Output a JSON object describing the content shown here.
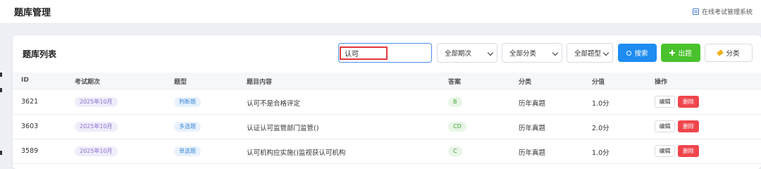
{
  "header": {
    "title": "题库管理",
    "system_link": "在线考试管理系统",
    "system_icon": "document-icon"
  },
  "panel": {
    "title": "题库列表",
    "search": {
      "value": "认可",
      "placeholder": ""
    },
    "filters": [
      {
        "label": "全部期次"
      },
      {
        "label": "全部分类"
      },
      {
        "label": "全部题型"
      }
    ],
    "buttons": {
      "search": "搜索",
      "exam": "出题",
      "category": "分类"
    }
  },
  "table": {
    "columns": [
      "ID",
      "考试期次",
      "题型",
      "题目内容",
      "答案",
      "分类",
      "分值",
      "操作"
    ],
    "rows": [
      {
        "id": "3621",
        "period": "2025年10月",
        "type": "判断题",
        "content": "认可不是合格评定",
        "answer": "B",
        "category": "历年真题",
        "score": "1.0分",
        "edit": "编辑",
        "delete": "删除"
      },
      {
        "id": "3603",
        "period": "2025年10月",
        "type": "多选题",
        "content": "认证认可监管部门监管()",
        "answer": "CD",
        "category": "历年真题",
        "score": "2.0分",
        "edit": "编辑",
        "delete": "删除"
      },
      {
        "id": "3589",
        "period": "2025年10月",
        "type": "单选题",
        "content": "认可机构应实施()监视获认可机构",
        "answer": "C",
        "category": "历年真题",
        "score": "1.0分",
        "edit": "编辑",
        "delete": "删除"
      }
    ]
  },
  "colors": {
    "primary": "#1f8cf1",
    "success": "#4ac22e",
    "danger": "#f0454c",
    "highlight": "#e0393e"
  }
}
